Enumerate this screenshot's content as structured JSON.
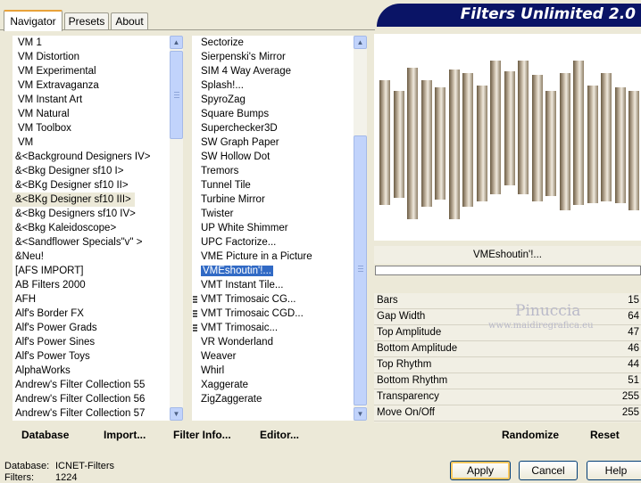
{
  "tabs": [
    {
      "label": "Navigator"
    },
    {
      "label": "Presets"
    },
    {
      "label": "About"
    }
  ],
  "banner": {
    "title": "Filters Unlimited 2.0"
  },
  "categories": [
    "VM 1",
    "VM Distortion",
    "VM Experimental",
    "VM Extravaganza",
    "VM Instant Art",
    "VM Natural",
    "VM Toolbox",
    "VM",
    "&<Background Designers IV>",
    "&<Bkg Designer sf10 I>",
    "&<BKg Designer sf10 II>",
    "&<BKg Designer sf10 III>",
    "&<Bkg Designers sf10 IV>",
    "&<Bkg Kaleidoscope>",
    "&<Sandflower Specials\"v\" >",
    "&Neu!",
    "[AFS IMPORT]",
    "AB Filters 2000",
    "AFH",
    "Alf's Border FX",
    "Alf's Power Grads",
    "Alf's Power Sines",
    "Alf's Power Toys",
    "AlphaWorks",
    "Andrew's Filter Collection 55",
    "Andrew's Filter Collection 56",
    "Andrew's Filter Collection 57"
  ],
  "selected_category": "&<BKg Designer sf10 III>",
  "filters": [
    {
      "name": "Sectorize",
      "mark": false
    },
    {
      "name": "Sierpenski's Mirror",
      "mark": false
    },
    {
      "name": "SIM 4 Way Average",
      "mark": false
    },
    {
      "name": "Splash!...",
      "mark": false
    },
    {
      "name": "SpyroZag",
      "mark": false
    },
    {
      "name": "Square Bumps",
      "mark": false
    },
    {
      "name": "Superchecker3D",
      "mark": false
    },
    {
      "name": "SW Graph Paper",
      "mark": false
    },
    {
      "name": "SW Hollow Dot",
      "mark": false
    },
    {
      "name": "Tremors",
      "mark": false
    },
    {
      "name": "Tunnel Tile",
      "mark": false
    },
    {
      "name": "Turbine Mirror",
      "mark": false
    },
    {
      "name": "Twister",
      "mark": false
    },
    {
      "name": "UP White Shimmer",
      "mark": false
    },
    {
      "name": "UPC Factorize...",
      "mark": false
    },
    {
      "name": "VME Picture in a Picture",
      "mark": false
    },
    {
      "name": "VMEshoutin'!...",
      "mark": false
    },
    {
      "name": "VMT Instant Tile...",
      "mark": false
    },
    {
      "name": "VMT Trimosaic CG...",
      "mark": true
    },
    {
      "name": "VMT Trimosaic CGD...",
      "mark": true
    },
    {
      "name": "VMT Trimosaic...",
      "mark": true
    },
    {
      "name": "VR Wonderland",
      "mark": false
    },
    {
      "name": "Weaver",
      "mark": false
    },
    {
      "name": "Whirl",
      "mark": false
    },
    {
      "name": "Xaggerate",
      "mark": false
    },
    {
      "name": "ZigZaggerate",
      "mark": false
    }
  ],
  "selected_filter": "VMEshoutin'!...",
  "toolbar": {
    "database": "Database",
    "import": "Import...",
    "filter_info": "Filter Info...",
    "editor": "Editor...",
    "randomize": "Randomize",
    "reset": "Reset"
  },
  "preview": {
    "filter_name": "VMEshoutin'!...",
    "progress": 0
  },
  "params": [
    {
      "label": "Bars",
      "value": "15"
    },
    {
      "label": "Gap Width",
      "value": "64"
    },
    {
      "label": "Top Amplitude",
      "value": "47"
    },
    {
      "label": "Bottom Amplitude",
      "value": "46"
    },
    {
      "label": "Top Rhythm",
      "value": "44"
    },
    {
      "label": "Bottom Rhythm",
      "value": "51"
    },
    {
      "label": "Transparency",
      "value": "255"
    },
    {
      "label": "Move On/Off",
      "value": "255"
    }
  ],
  "watermark": {
    "name": "Pinuccia",
    "url": "www.maidiregrafica.eu"
  },
  "status": {
    "database_label": "Database:",
    "database_value": "ICNET-Filters",
    "filters_label": "Filters:",
    "filters_value": "1224"
  },
  "buttons": {
    "apply": "Apply",
    "cancel": "Cancel",
    "help": "Help"
  },
  "colors": {
    "banner": "#0a1466",
    "selection": "#316ac5",
    "face": "#ece9d8"
  }
}
